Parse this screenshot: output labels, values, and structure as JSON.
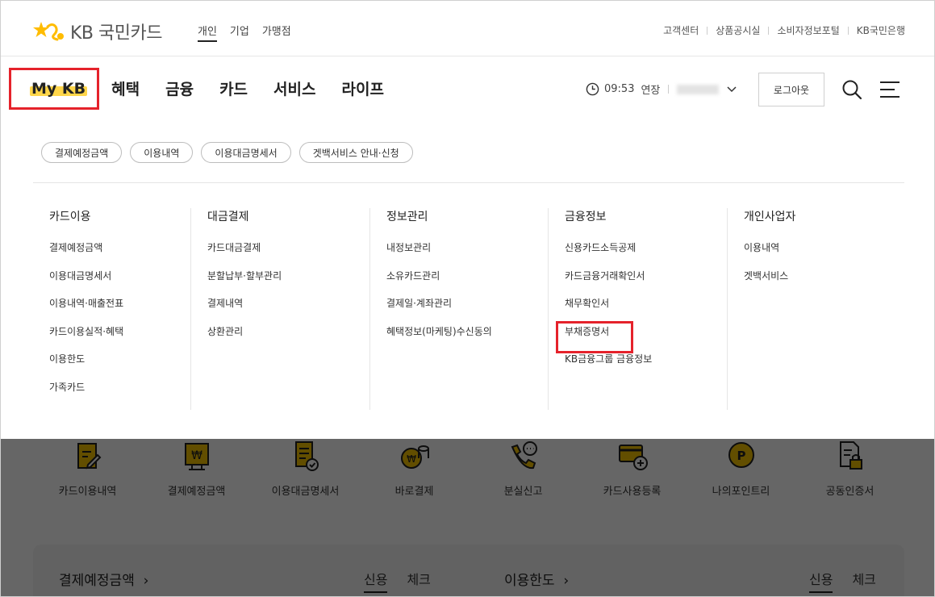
{
  "brand": {
    "logo_text": "KB 국민카드",
    "accent_color": "#ffbc00",
    "highlight_red": "#e5222b"
  },
  "segments": [
    "개인",
    "기업",
    "가맹점"
  ],
  "util_links": [
    "고객센터",
    "상품공시실",
    "소비자정보포털",
    "KB국민은행"
  ],
  "main_menu": [
    "My KB",
    "혜택",
    "금융",
    "카드",
    "서비스",
    "라이프"
  ],
  "session": {
    "time": "09:53",
    "extend_label": "연장"
  },
  "logout_label": "로그아웃",
  "chips": [
    "결제예정금액",
    "이용내역",
    "이용대금명세서",
    "겟백서비스 안내·신청"
  ],
  "columns": [
    {
      "title": "카드이용",
      "items": [
        "결제예정금액",
        "이용대금명세서",
        "이용내역·매출전표",
        "카드이용실적·혜택",
        "이용한도",
        "가족카드"
      ]
    },
    {
      "title": "대금결제",
      "items": [
        "카드대금결제",
        "분할납부·할부관리",
        "결제내역",
        "상환관리"
      ]
    },
    {
      "title": "정보관리",
      "items": [
        "내정보관리",
        "소유카드관리",
        "결제일·계좌관리",
        "혜택정보(마케팅)수신동의"
      ]
    },
    {
      "title": "금융정보",
      "items": [
        "신용카드소득공제",
        "카드금융거래확인서",
        "채무확인서",
        "부채증명서",
        "KB금융그룹 금융정보"
      ]
    },
    {
      "title": "개인사업자",
      "items": [
        "이용내역",
        "겟백서비스"
      ]
    }
  ],
  "quick_menu": [
    "카드이용내역",
    "결제예정금액",
    "이용대금명세서",
    "바로결제",
    "분실신고",
    "카드사용등록",
    "나의포인트리",
    "공동인증서"
  ],
  "summary": {
    "left_title": "결제예정금액",
    "right_title": "이용한도",
    "tab_credit": "신용",
    "tab_check": "체크"
  }
}
